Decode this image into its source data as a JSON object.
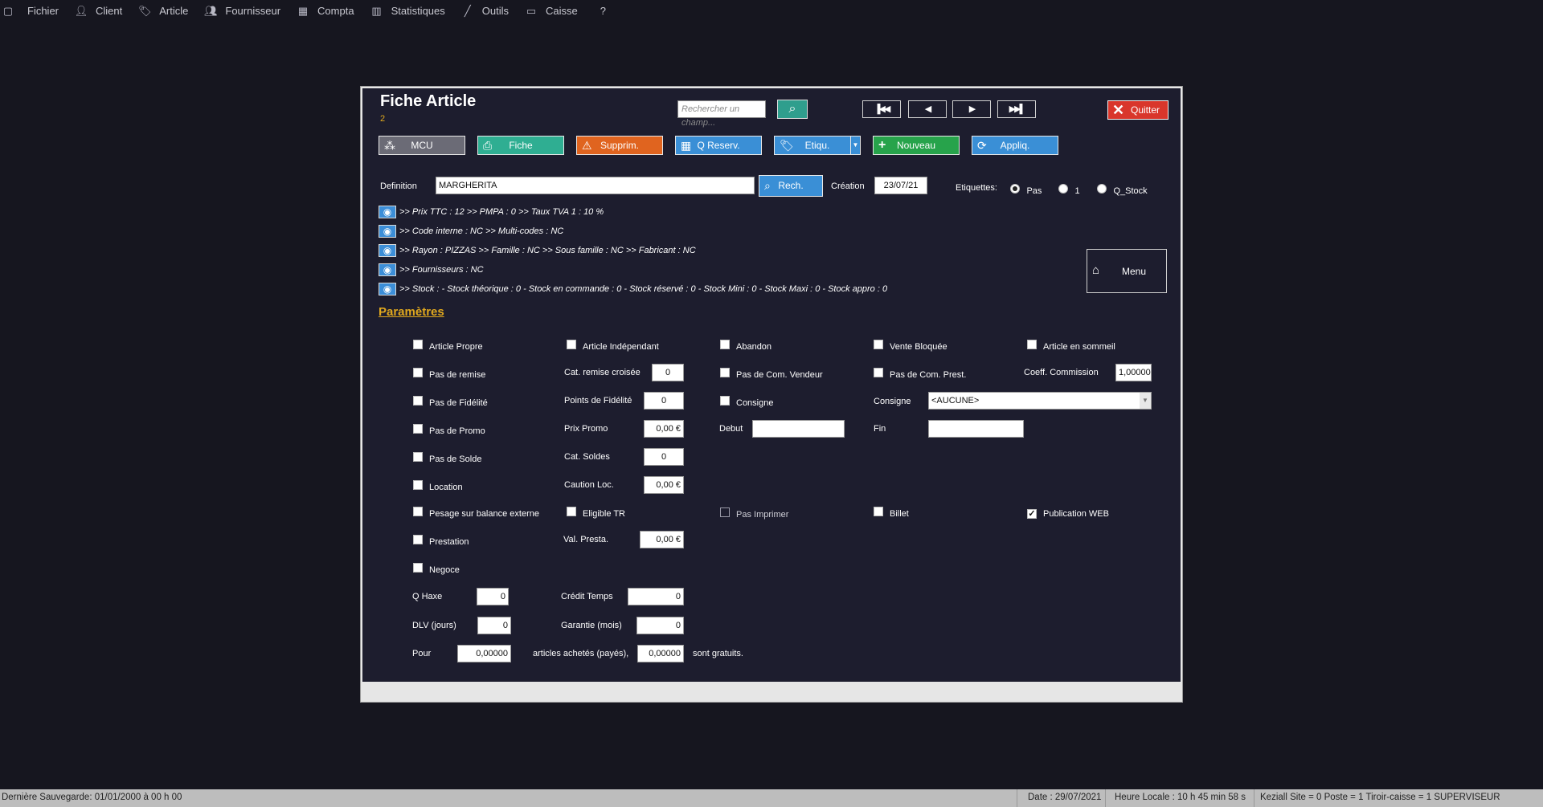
{
  "menubar": {
    "items": [
      {
        "label": "Fichier",
        "icon": "window-icon"
      },
      {
        "label": "Client",
        "icon": "person-icon"
      },
      {
        "label": "Article",
        "icon": "tag-icon"
      },
      {
        "label": "Fournisseur",
        "icon": "people-icon"
      },
      {
        "label": "Compta",
        "icon": "calculator-icon"
      },
      {
        "label": "Statistiques",
        "icon": "bar-chart-icon"
      },
      {
        "label": "Outils",
        "icon": "wand-icon"
      },
      {
        "label": "Caisse",
        "icon": "monitor-icon"
      },
      {
        "label": "?",
        "icon": ""
      }
    ]
  },
  "header": {
    "title": "Fiche Article",
    "subnum": "2",
    "search_placeholder": "Rechercher un champ...",
    "quit_label": "Quitter"
  },
  "toolbar": {
    "mcu": "MCU",
    "fiche": "Fiche",
    "supprim": "Supprim.",
    "qreserv": "Q Reserv.",
    "etiqu": "Etiqu.",
    "nouveau": "Nouveau",
    "appliq": "Appliq."
  },
  "definition": {
    "label": "Definition",
    "value": "MARGHERITA",
    "rech": "Rech.",
    "creation_label": "Création",
    "creation_value": "23/07/21",
    "etiquettes_label": "Etiquettes:",
    "radio_pas": "Pas",
    "radio_1": "1",
    "radio_qstock": "Q_Stock"
  },
  "info_lines": [
    ">> Prix TTC : 12 >> PMPA : 0 >> Taux TVA 1 : 10 %",
    ">> Code interne : NC >> Multi-codes : NC",
    ">> Rayon : PIZZAS >> Famille : NC >> Sous famille : NC >> Fabricant : NC",
    ">> Fournisseurs : NC",
    ">> Stock : - Stock théorique : 0 - Stock en commande : 0 - Stock réservé : 0 - Stock Mini : 0 - Stock Maxi : 0 - Stock appro : 0"
  ],
  "menu_button": "Menu",
  "params": {
    "title": "Paramètres",
    "col1": [
      "Article Propre",
      "Pas de remise",
      "Pas de Fidélité",
      "Pas de Promo",
      "Pas de Solde",
      "Location",
      "Pesage sur balance externe",
      "Prestation",
      "Negoce"
    ],
    "article_independant": "Article Indépendant",
    "abandon": "Abandon",
    "vente_bloquee": "Vente Bloquée",
    "article_sommeil": "Article en sommeil",
    "cat_remise_label": "Cat. remise croisée",
    "cat_remise_value": "0",
    "pas_com_vendeur": "Pas de Com. Vendeur",
    "pas_com_prest": "Pas de Com. Prest.",
    "coeff_label": "Coeff. Commission",
    "coeff_value": "1,00000",
    "points_fid_label": "Points de Fidélité",
    "points_fid_value": "0",
    "consigne_cb": "Consigne",
    "consigne_label": "Consigne",
    "consigne_value": "<AUCUNE>",
    "prix_promo_label": "Prix Promo",
    "prix_promo_value": "0,00 €",
    "debut_label": "Debut",
    "fin_label": "Fin",
    "cat_soldes_label": "Cat. Soldes",
    "cat_soldes_value": "0",
    "caution_label": "Caution Loc.",
    "caution_value": "0,00 €",
    "eligible_tr": "Eligible TR",
    "pas_imprimer": "Pas Imprimer",
    "billet": "Billet",
    "publication_web": "Publication WEB",
    "val_presta_label": "Val. Presta.",
    "val_presta_value": "0,00 €",
    "qhaxe_label": "Q Haxe",
    "qhaxe_value": "0",
    "credit_temps_label": "Crédit Temps",
    "credit_temps_value": "0",
    "dlv_label": "DLV (jours)",
    "dlv_value": "0",
    "garantie_label": "Garantie (mois)",
    "garantie_value": "0",
    "pour_label": "Pour",
    "pour_value": "0,00000",
    "articles_label": "articles achetés (payés),",
    "articles_value": "0,00000",
    "gratuits_label": "sont gratuits."
  },
  "statusbar": {
    "sauvegarde": "Dernière Sauvegarde: 01/01/2000 à 00 h 00",
    "date": "Date : 29/07/2021",
    "heure": "Heure Locale : 10 h 45 min 58 s",
    "info": "Keziall  Site = 0   Poste = 1   Tiroir-caisse = 1  SUPERVISEUR"
  }
}
